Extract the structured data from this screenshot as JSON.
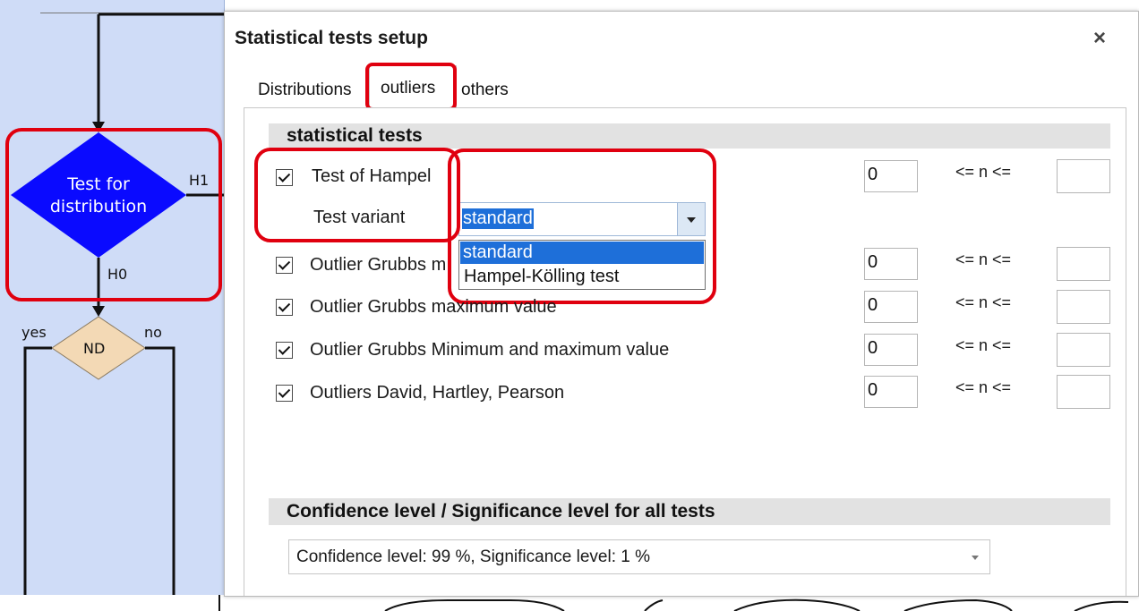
{
  "flow": {
    "decision_label_line1": "Test for",
    "decision_label_line2": "distribution",
    "branch_h1": "H1",
    "branch_h0": "H0",
    "nd_label": "ND",
    "yes_label": "yes",
    "no_label": "no",
    "colors": {
      "decision": "#0a0aff",
      "nd": "#f3d9b5",
      "background": "#cfdcf7",
      "highlight": "#e0000f"
    }
  },
  "dialog": {
    "title": "Statistical tests setup",
    "close_glyph": "×",
    "tabs": [
      {
        "label": "Distributions",
        "active": false
      },
      {
        "label": "outliers",
        "active": true
      },
      {
        "label": "others",
        "active": false
      }
    ],
    "section_tests_title": "statistical tests",
    "tests": [
      {
        "label": "Test of Hampel",
        "checked": true,
        "n_min": "0",
        "relation": "<= n <=",
        "n_max": ""
      },
      {
        "label": "Outlier Grubbs m",
        "checked": true,
        "n_min": "0",
        "relation": "<= n <=",
        "n_max": ""
      },
      {
        "label": "Outlier Grubbs maximum value",
        "checked": true,
        "n_min": "0",
        "relation": "<= n <=",
        "n_max": ""
      },
      {
        "label": "Outlier Grubbs Minimum and maximum value",
        "checked": true,
        "n_min": "0",
        "relation": "<= n <=",
        "n_max": ""
      },
      {
        "label": "Outliers David, Hartley, Pearson",
        "checked": true,
        "n_min": "0",
        "relation": "<= n <=",
        "n_max": ""
      }
    ],
    "test_variant_label": "Test variant",
    "test_variant_value": "standard",
    "test_variant_options": [
      "standard",
      "Hampel-Kölling test"
    ],
    "section_conf_title": "Confidence level / Significance level for all tests",
    "confidence_value": "Confidence level: 99 %, Significance level: 1 %"
  }
}
